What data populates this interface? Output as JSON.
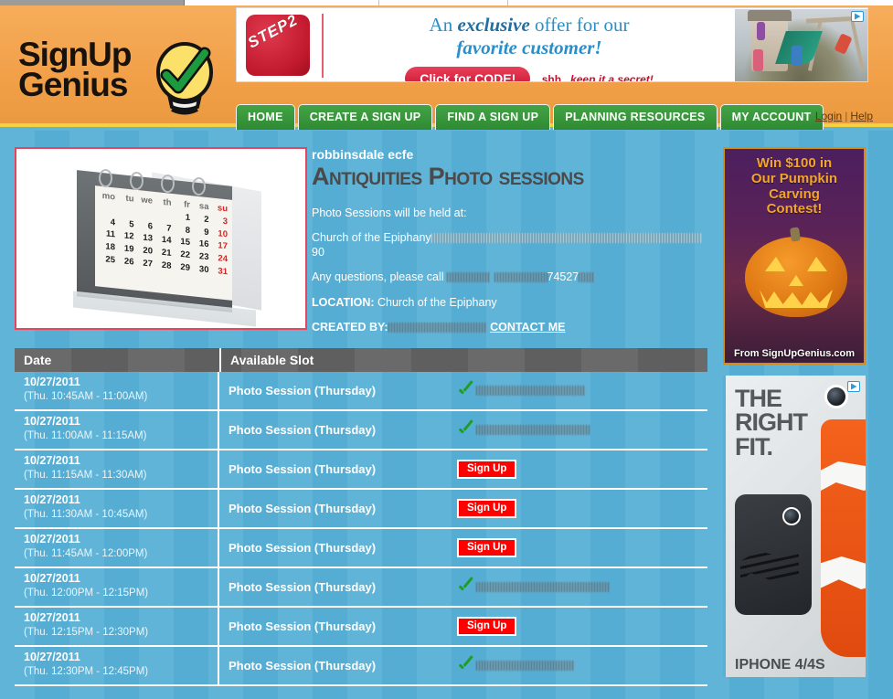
{
  "site": {
    "logo_line1": "SignUp",
    "logo_line2": "Genius",
    "bulb_icon": "lightbulb-check-icon"
  },
  "banner_ad": {
    "brand": "STEP2",
    "line1_pre": "An ",
    "line1_em": "exclusive",
    "line1_post": " offer for our",
    "line2": "favorite customer!",
    "cta": "Click for CODE!",
    "secret_pre": "shh...",
    "secret_em": "keep it a secret!",
    "adchoices_icon": "adchoices-icon"
  },
  "nav": {
    "items": [
      {
        "label": "HOME",
        "name": "nav-home"
      },
      {
        "label": "CREATE A SIGN UP",
        "name": "nav-create-a-sign-up"
      },
      {
        "label": "FIND A SIGN UP",
        "name": "nav-find-a-sign-up"
      },
      {
        "label": "PLANNING RESOURCES",
        "name": "nav-planning-resources"
      },
      {
        "label": "MY ACCOUNT",
        "name": "nav-my-account"
      }
    ],
    "login": "Login",
    "separator": "|",
    "help": "Help"
  },
  "hero": {
    "image_alt": "desk-calendar-image",
    "calendar": {
      "days": [
        "mo",
        "tu",
        "we",
        "th",
        "fr",
        "sa",
        "su"
      ],
      "weeks": [
        [
          "",
          "",
          "",
          "",
          "1",
          "2",
          "3"
        ],
        [
          "4",
          "5",
          "6",
          "7",
          "8",
          "9",
          "10"
        ],
        [
          "11",
          "12",
          "13",
          "14",
          "15",
          "16",
          "17"
        ],
        [
          "18",
          "19",
          "20",
          "21",
          "22",
          "23",
          "24"
        ],
        [
          "25",
          "26",
          "27",
          "28",
          "29",
          "30",
          "31"
        ]
      ]
    }
  },
  "signup": {
    "group": "robbinsdale ecfe",
    "title": "Antiquities Photo sessions",
    "desc_line1": "Photo Sessions will be held at:",
    "desc_line2_visible": "Church of the Epiphany",
    "desc_line2_tail": "90",
    "desc_line3_visible": "Any questions, please call",
    "desc_line3_tail": "74527",
    "location_label": "LOCATION:",
    "location_value": "Church of the Epiphany",
    "created_by_label": "CREATED BY:",
    "contact_link": "CONTACT ME"
  },
  "table": {
    "headers": {
      "date": "Date",
      "slot": "Available Slot"
    },
    "signup_button_label": "Sign Up",
    "filled_icon": "green-check-icon",
    "rows": [
      {
        "date": "10/27/2011",
        "time": "(Thu. 10:45AM - 11:00AM)",
        "slot": "Photo Session (Thursday)",
        "status": "filled",
        "name_redacted": true
      },
      {
        "date": "10/27/2011",
        "time": "(Thu. 11:00AM - 11:15AM)",
        "slot": "Photo Session (Thursday)",
        "status": "filled",
        "name_redacted": true
      },
      {
        "date": "10/27/2011",
        "time": "(Thu. 11:15AM - 11:30AM)",
        "slot": "Photo Session (Thursday)",
        "status": "open"
      },
      {
        "date": "10/27/2011",
        "time": "(Thu. 11:30AM - 10:45AM)",
        "slot": "Photo Session (Thursday)",
        "status": "open"
      },
      {
        "date": "10/27/2011",
        "time": "(Thu. 11:45AM - 12:00PM)",
        "slot": "Photo Session (Thursday)",
        "status": "open"
      },
      {
        "date": "10/27/2011",
        "time": "(Thu. 12:00PM - 12:15PM)",
        "slot": "Photo Session (Thursday)",
        "status": "filled",
        "name_redacted": true
      },
      {
        "date": "10/27/2011",
        "time": "(Thu. 12:15PM - 12:30PM)",
        "slot": "Photo Session (Thursday)",
        "status": "open"
      },
      {
        "date": "10/27/2011",
        "time": "(Thu. 12:30PM - 12:45PM)",
        "slot": "Photo Session (Thursday)",
        "status": "filled",
        "name_redacted": true
      }
    ]
  },
  "ads": {
    "pumpkin": {
      "line1": "Win $100 in",
      "line2": "Our Pumpkin",
      "line3": "Carving",
      "line4": "Contest!",
      "footer": "From SignUpGenius.com",
      "image_alt": "jack-o-lantern-image"
    },
    "phone": {
      "line1": "THE",
      "line2": "RIGHT",
      "line3": "FIT.",
      "footer": "IPHONE 4/4S",
      "image_alt": "iphone-cases-image",
      "adchoices_icon": "adchoices-icon"
    }
  },
  "colors": {
    "header_orange": "#f2a14a",
    "nav_green": "#2f8a33",
    "page_blue": "#57b0d6",
    "signup_red": "#ff0000",
    "check_green": "#1f9e26",
    "title_gray": "#4a4a4a",
    "yellow_rule": "#f2d23f"
  }
}
